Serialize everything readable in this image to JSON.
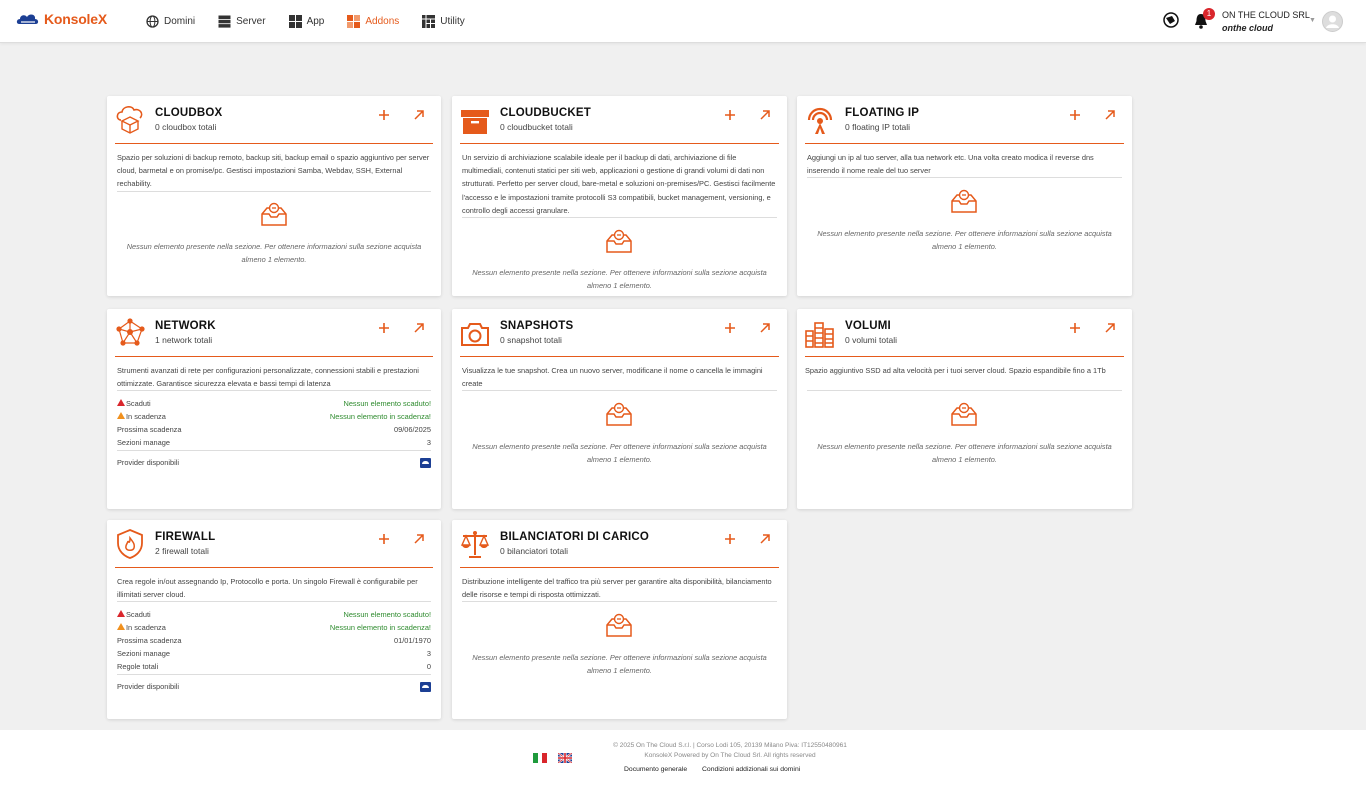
{
  "brand": {
    "name": "KonsoleX",
    "accent": "#e55a1b",
    "navy": "#1c3f94"
  },
  "nav": [
    {
      "label": "Domini",
      "icon": "globe-icon",
      "active": false
    },
    {
      "label": "Server",
      "icon": "server-icon",
      "active": false
    },
    {
      "label": "App",
      "icon": "grid-icon",
      "active": false
    },
    {
      "label": "Addons",
      "icon": "addons-icon",
      "active": true
    },
    {
      "label": "Utility",
      "icon": "utility-icon",
      "active": false
    }
  ],
  "header": {
    "notifications": "1",
    "company": "ON THE CLOUD SRL",
    "company_sub": "onthe cloud"
  },
  "empty_text": "Nessun elemento presente nella sezione. Per ottenere informazioni sulla sezione acquista almeno 1 elemento.",
  "cards": {
    "cloudbox": {
      "title": "CLOUDBOX",
      "count": "0 cloudbox totali",
      "desc": "Spazio per soluzioni di backup remoto, backup siti, backup email o spazio aggiuntivo per server cloud, barmetal e on promise/pc. Gestisci impostazioni Samba, Webdav, SSH, External rechability."
    },
    "cloudbucket": {
      "title": "CLOUDBUCKET",
      "count": "0 cloudbucket totali",
      "desc": "Un servizio di archiviazione scalabile ideale per il backup di dati, archiviazione di file multimediali, contenuti statici per siti web, applicazioni o gestione di grandi volumi di dati non strutturati. Perfetto per server cloud, bare-metal e soluzioni on-premises/PC. Gestisci facilmente l'accesso e le impostazioni tramite protocolli S3 compatibili, bucket management, versioning, e controllo degli accessi granulare."
    },
    "floatingip": {
      "title": "FLOATING IP",
      "count": "0 floating IP totali",
      "desc": "Aggiungi un ip al tuo server, alla tua network etc. Una volta creato modica il reverse dns inserendo il nome reale del tuo server"
    },
    "network": {
      "title": "NETWORK",
      "count": "1 network totali",
      "desc": "Strumenti avanzati di rete per configurazioni personalizzate, connessioni stabili e prestazioni ottimizzate. Garantisce sicurezza elevata e bassi tempi di latenza",
      "stats": [
        {
          "label": "Scaduti",
          "value": "Nessun elemento scaduto!",
          "warn": "red"
        },
        {
          "label": "In scadenza",
          "value": "Nessun elemento in scadenza!",
          "warn": "orange"
        },
        {
          "label": "Prossima scadenza",
          "value": "09/06/2025",
          "warn": ""
        },
        {
          "label": "Sezioni manage",
          "value": "3",
          "warn": ""
        }
      ],
      "provider": "Provider disponibili"
    },
    "snapshots": {
      "title": "SNAPSHOTS",
      "count": "0 snapshot totali",
      "desc": "Visualizza le tue snapshot. Crea un nuovo server, modificane il nome o cancella le immagini create"
    },
    "volumi": {
      "title": "VOLUMI",
      "count": "0 volumi totali",
      "desc": "Spazio aggiuntivo SSD ad alta velocità per i tuoi server cloud. Spazio espandibile fino a 1Tb"
    },
    "firewall": {
      "title": "FIREWALL",
      "count": "2 firewall totali",
      "desc": "Crea regole in/out assegnando Ip, Protocollo e porta. Un singolo Firewall è configurabile per illimitati server cloud.",
      "stats": [
        {
          "label": "Scaduti",
          "value": "Nessun elemento scaduto!",
          "warn": "red"
        },
        {
          "label": "In scadenza",
          "value": "Nessun elemento in scadenza!",
          "warn": "orange"
        },
        {
          "label": "Prossima scadenza",
          "value": "01/01/1970",
          "warn": ""
        },
        {
          "label": "Sezioni manage",
          "value": "3",
          "warn": ""
        },
        {
          "label": "Regole totali",
          "value": "0",
          "warn": ""
        }
      ],
      "provider": "Provider disponibili"
    },
    "bilanciatori": {
      "title": "BILANCIATORI DI CARICO",
      "count": "0 bilanciatori totali",
      "desc": "Distribuzione intelligente del traffico tra più server per garantire alta disponibilità, bilanciamento delle risorse e tempi di risposta ottimizzati."
    }
  },
  "footer": {
    "copy1": "© 2025 On The Cloud S.r.l. | Corso Lodi 105, 20139 Milano Piva: IT12550480961",
    "copy2": "KonsoleX Powered by On The Cloud Srl. All rights reserved",
    "link1": "Documento generale",
    "link2": "Condizioni addizionali sui domini"
  }
}
